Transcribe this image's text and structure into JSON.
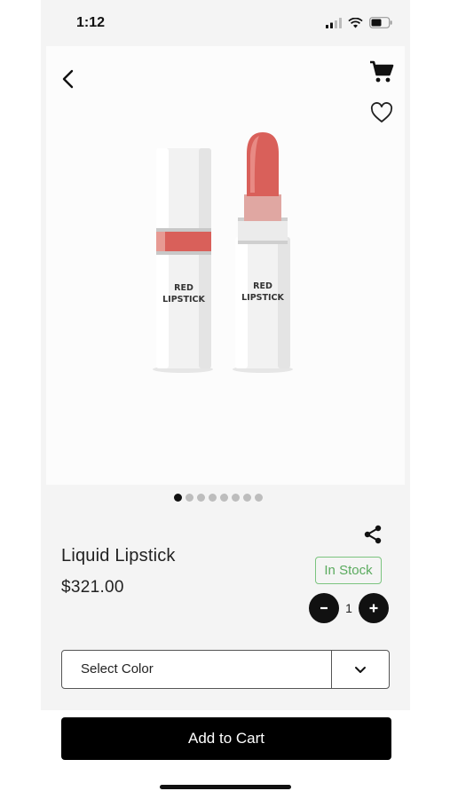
{
  "status_bar": {
    "time": "1:12"
  },
  "header": {
    "back_icon": "chevron-left-icon",
    "cart_icon": "cart-icon",
    "favorite_icon": "heart-icon"
  },
  "product_image": {
    "caption_line1": "RED",
    "caption_line2": "LIPSTICK",
    "lipstick_color": "#d9605a"
  },
  "carousel": {
    "dot_count": 8,
    "active_index": 0
  },
  "product": {
    "name": "Liquid Lipstick",
    "price": "$321.00",
    "stock_status": "In Stock",
    "quantity": "1"
  },
  "quantity_controls": {
    "minus_label": "-",
    "plus_label": "+"
  },
  "color_select": {
    "label": "Select Color"
  },
  "actions": {
    "add_to_cart_label": "Add to Cart"
  },
  "colors": {
    "stock_green": "#5aaa5e",
    "primary": "#000000"
  }
}
